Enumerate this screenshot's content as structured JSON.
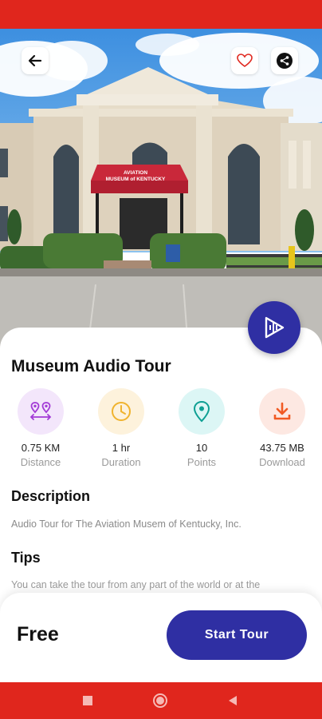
{
  "colors": {
    "status_bar": "#e0261d",
    "primary": "#2f2fa3",
    "distance_tint": "#f3e6fb",
    "duration_tint": "#fdf2dc",
    "points_tint": "#dcf6f5",
    "download_tint": "#fde8e2"
  },
  "hero": {
    "sign_line1": "AVIATION",
    "sign_line2": "MUSEUM of KENTUCKY"
  },
  "header": {
    "back_icon": "arrow-left-icon",
    "favorite_icon": "heart-outline-icon",
    "share_icon": "share-icon"
  },
  "tour": {
    "title": "Museum Audio Tour",
    "play_icon": "play-audio-icon"
  },
  "stats": [
    {
      "value": "0.75 KM",
      "label": "Distance",
      "icon": "route-icon"
    },
    {
      "value": "1 hr",
      "label": "Duration",
      "icon": "clock-icon"
    },
    {
      "value": "10",
      "label": "Points",
      "icon": "location-pin-icon"
    },
    {
      "value": "43.75 MB",
      "label": "Download",
      "icon": "download-icon"
    }
  ],
  "description": {
    "heading": "Description",
    "text": "Audio Tour for The Aviation Musem of Kentucky, Inc."
  },
  "tips": {
    "heading": "Tips",
    "text": "You can take the tour from any part of the world or at the"
  },
  "footer": {
    "price": "Free",
    "start_label": "Start Tour"
  },
  "nav": {
    "recents_icon": "square-icon",
    "home_icon": "circle-icon",
    "back_icon": "triangle-back-icon"
  }
}
